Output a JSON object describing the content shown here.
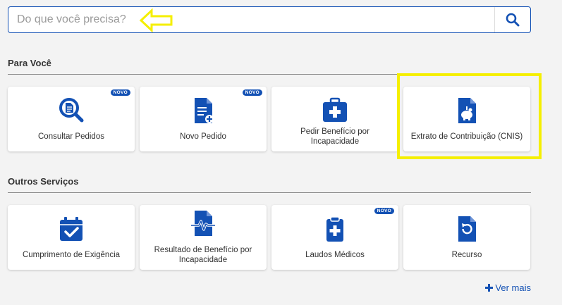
{
  "search": {
    "placeholder": "Do que você precisa?"
  },
  "para_voce": {
    "title": "Para Você",
    "cards": [
      {
        "label": "Consultar Pedidos",
        "badge": "NOVO",
        "icon": "search-document-icon"
      },
      {
        "label": "Novo Pedido",
        "badge": "NOVO",
        "icon": "new-document-icon"
      },
      {
        "label": "Pedir Benefício por Incapacidade",
        "badge": "",
        "icon": "medical-kit-icon"
      },
      {
        "label": "Extrato de Contribuição (CNIS)",
        "badge": "",
        "icon": "piggy-bank-document-icon"
      }
    ]
  },
  "outros_servicos": {
    "title": "Outros Serviços",
    "cards": [
      {
        "label": "Cumprimento de Exigência",
        "badge": "",
        "icon": "calendar-check-icon"
      },
      {
        "label": "Resultado de Benefício por Incapacidade",
        "badge": "",
        "icon": "heartbeat-document-icon"
      },
      {
        "label": "Laudos Médicos",
        "badge": "NOVO",
        "icon": "medical-clipboard-icon"
      },
      {
        "label": "Recurso",
        "badge": "",
        "icon": "refresh-document-icon"
      }
    ]
  },
  "ver_mais": "Ver mais",
  "colors": {
    "brand": "#1351b4",
    "highlight": "#f5ef00",
    "background": "#f3f3f3"
  }
}
